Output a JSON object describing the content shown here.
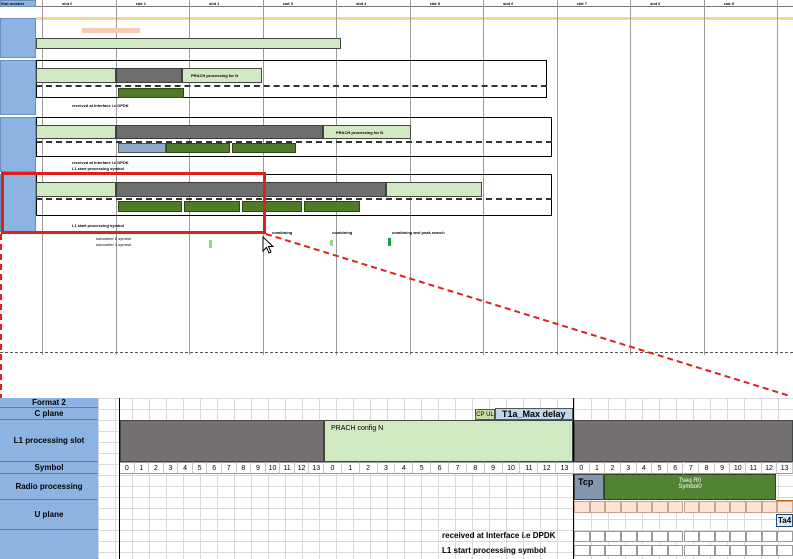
{
  "overview": {
    "header_label": "Slot number",
    "slot_labels": [
      "slot 0",
      "slot 1",
      "slot 2",
      "slot 3",
      "slot 4",
      "slot 5",
      "slot 6",
      "slot 7",
      "slot 8",
      "slot 9",
      "slot 10"
    ],
    "panel1": {
      "bar1": "PRACH processing for N",
      "bar2": "received at Interface i.e DPDK",
      "bar3": "L1 start processing symbol"
    },
    "panel2": {
      "bar1": "PRACH processing for N",
      "bar2": "received at Interface i.e DPDK",
      "bar3": "L1 start processing symbol"
    },
    "panel3": {
      "bar3": "L1 start processing symbol",
      "combine1": "combining",
      "combine2": "combining",
      "combine3": "combining and peak search"
    },
    "legend_a": "subcarrier 0 symbol",
    "legend_b": "subcarrier 1 symbol"
  },
  "detail": {
    "labels": {
      "format": "Format 2",
      "cplane": "C plane",
      "l1": "L1 processing slot",
      "symbol": "Symbol",
      "radio": "Radio processing",
      "uplane": "U plane"
    },
    "cp_ul": "CP UL",
    "t1a": "T1a_Max delay",
    "prach_config": "PRACH config N",
    "symbols_a": [
      "0",
      "1",
      "2",
      "3",
      "4",
      "5",
      "6",
      "7",
      "8",
      "9",
      "10",
      "11",
      "12",
      "13"
    ],
    "symbols_b": [
      "0",
      "1",
      "2",
      "3",
      "4",
      "5",
      "6",
      "7",
      "8",
      "9",
      "10",
      "11",
      "12",
      "13"
    ],
    "symbols_c": [
      "0",
      "1",
      "2",
      "3",
      "4",
      "5",
      "6",
      "7",
      "8",
      "9",
      "10",
      "11",
      "12",
      "13"
    ],
    "tcp": "Tcp",
    "tseq": "Tseq R0",
    "symbol_zero": "Symbol0",
    "ta4": "Ta4",
    "received": "received at Interface i.e DPDK",
    "l1start": "L1 start processing symbol"
  },
  "colors": {
    "label_blue": "#8db3e2",
    "light_green": "#d0e9c2",
    "dark_green": "#4f7a28",
    "grey": "#6e6e6e",
    "callout_red": "#e0201b",
    "cp_ul_green": "#c4e1a3",
    "t1a_blue": "#bdd7ee",
    "ta4_blue": "#1f4e79",
    "orange": "#c55a11"
  },
  "icons": {
    "cursor": "mouse-pointer-icon"
  }
}
